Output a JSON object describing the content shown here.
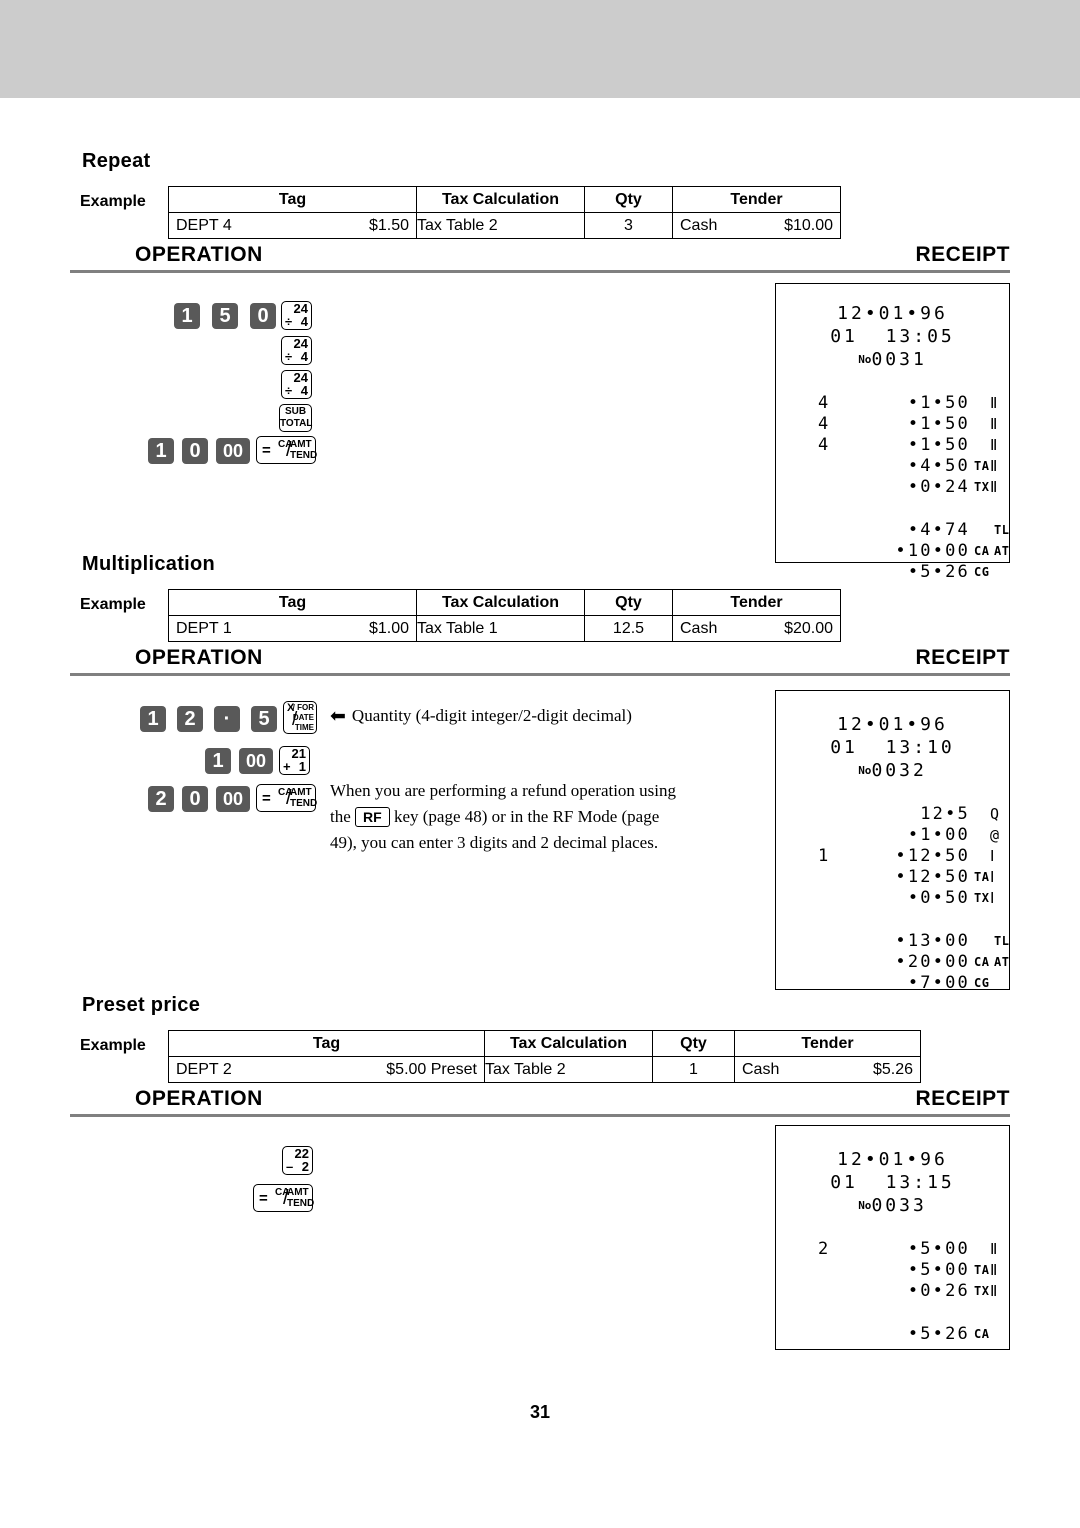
{
  "page": {
    "number": "31",
    "operation_label": "OPERATION",
    "receipt_label": "RECEIPT",
    "example_label": "Example"
  },
  "table_headers": {
    "tag": "Tag",
    "tax_calculation": "Tax Calculation",
    "qty": "Qty",
    "tender": "Tender"
  },
  "sections": [
    {
      "title": "Repeat",
      "example": {
        "tag_name": "DEPT 4",
        "tag_price": "$1.50",
        "tax_calculation": "Tax Table 2",
        "qty": "3",
        "tender_type": "Cash",
        "tender_amount": "$10.00"
      },
      "keys": [
        {
          "type": "num",
          "label": "1"
        },
        {
          "type": "num",
          "label": "5"
        },
        {
          "type": "num",
          "label": "0"
        },
        {
          "type": "dept",
          "top": "24",
          "op": "÷",
          "bottom": "4"
        },
        {
          "type": "dept",
          "top": "24",
          "op": "÷",
          "bottom": "4"
        },
        {
          "type": "dept",
          "top": "24",
          "op": "÷",
          "bottom": "4"
        },
        {
          "type": "subtotal",
          "line1": "SUB",
          "line2": "TOTAL"
        },
        {
          "type": "num",
          "label": "1"
        },
        {
          "type": "num",
          "label": "0"
        },
        {
          "type": "num2",
          "label": "00"
        },
        {
          "type": "ca",
          "eq": "=",
          "t1": "CA",
          "t2": "AMT",
          "t3": "TEND"
        }
      ],
      "receipt": {
        "date": "12•01•96",
        "clerk_time": "01  13:05",
        "no_prefix": "No",
        "no_value": "0031",
        "lines": [
          {
            "qty": "4",
            "amount": "•1•50",
            "sym": "",
            "sym2": "",
            "symbig": "Ⅱ"
          },
          {
            "qty": "4",
            "amount": "•1•50",
            "sym": "",
            "sym2": "",
            "symbig": "Ⅱ"
          },
          {
            "qty": "4",
            "amount": "•1•50",
            "sym": "",
            "sym2": "",
            "symbig": "Ⅱ"
          },
          {
            "qty": "",
            "amount": "•4•50",
            "sym": "TA",
            "sym2": "",
            "symbig": "Ⅱ"
          },
          {
            "qty": "",
            "amount": "•0•24",
            "sym": "TX",
            "sym2": "",
            "symbig": "Ⅱ"
          },
          {
            "gap": true
          },
          {
            "qty": "",
            "amount": "•4•74",
            "sym": "",
            "sym2": "TL",
            "symbig": ""
          },
          {
            "qty": "",
            "amount": "•10•00",
            "sym": "CA",
            "sym2": "AT",
            "symbig": ""
          },
          {
            "qty": "",
            "amount": "•5•26",
            "sym": "CG",
            "sym2": "",
            "symbig": ""
          }
        ]
      }
    },
    {
      "title": "Multiplication",
      "example": {
        "tag_name": "DEPT 1",
        "tag_price": "$1.00",
        "tax_calculation": "Tax Table 1",
        "qty": "12.5",
        "tender_type": "Cash",
        "tender_amount": "$20.00"
      },
      "keys": [
        {
          "type": "num",
          "label": "1"
        },
        {
          "type": "num",
          "label": "2"
        },
        {
          "type": "num",
          "label": "·"
        },
        {
          "type": "num",
          "label": "5"
        },
        {
          "type": "xfor",
          "x": "X",
          "a": "/ FOR",
          "b": "DATE",
          "c": "TIME"
        },
        {
          "type": "num",
          "label": "1"
        },
        {
          "type": "num2",
          "label": "00"
        },
        {
          "type": "dept",
          "top": "21",
          "op": "+",
          "bottom": "1"
        },
        {
          "type": "num",
          "label": "2"
        },
        {
          "type": "num",
          "label": "0"
        },
        {
          "type": "num2",
          "label": "00"
        },
        {
          "type": "ca",
          "eq": "=",
          "t1": "CA",
          "t2": "AMT",
          "t3": "TEND"
        }
      ],
      "annotation": "Quantity (4-digit integer/2-digit decimal)",
      "note_part1": "When you are performing a refund operation using",
      "note_part2_before": "the",
      "note_rf_key": "RF",
      "note_part2_after": "key (page 48) or in the RF Mode (page",
      "note_part3": "49),  you can enter 3 digits and 2 decimal places.",
      "receipt": {
        "date": "12•01•96",
        "clerk_time": "01  13:10",
        "no_prefix": "No",
        "no_value": "0032",
        "lines": [
          {
            "qty": "",
            "amount": "12•5",
            "sym": "",
            "sym2": "",
            "symbig": "Q"
          },
          {
            "qty": "",
            "amount": "•1•00",
            "sym": "",
            "sym2": "",
            "symbig": "@"
          },
          {
            "qty": "1",
            "amount": "•12•50",
            "sym": "",
            "sym2": "",
            "symbig": "Ⅰ"
          },
          {
            "qty": "",
            "amount": "•12•50",
            "sym": "TA",
            "sym2": "",
            "symbig": "Ⅰ"
          },
          {
            "qty": "",
            "amount": "•0•50",
            "sym": "TX",
            "sym2": "",
            "symbig": "Ⅰ"
          },
          {
            "gap": true
          },
          {
            "qty": "",
            "amount": "•13•00",
            "sym": "",
            "sym2": "TL",
            "symbig": ""
          },
          {
            "qty": "",
            "amount": "•20•00",
            "sym": "CA",
            "sym2": "AT",
            "symbig": ""
          },
          {
            "qty": "",
            "amount": "•7•00",
            "sym": "CG",
            "sym2": "",
            "symbig": ""
          }
        ]
      }
    },
    {
      "title": "Preset price",
      "example": {
        "tag_name": "DEPT 2",
        "tag_price": "$5.00 Preset",
        "tax_calculation": "Tax Table 2",
        "qty": "1",
        "tender_type": "Cash",
        "tender_amount": "$5.26"
      },
      "keys": [
        {
          "type": "dept",
          "top": "22",
          "op": "–",
          "bottom": "2"
        },
        {
          "type": "ca",
          "eq": "=",
          "t1": "CA",
          "t2": "AMT",
          "t3": "TEND"
        }
      ],
      "receipt": {
        "date": "12•01•96",
        "clerk_time": "01  13:15",
        "no_prefix": "No",
        "no_value": "0033",
        "lines": [
          {
            "qty": "2",
            "amount": "•5•00",
            "sym": "",
            "sym2": "",
            "symbig": "Ⅱ"
          },
          {
            "qty": "",
            "amount": "•5•00",
            "sym": "TA",
            "sym2": "",
            "symbig": "Ⅱ"
          },
          {
            "qty": "",
            "amount": "•0•26",
            "sym": "TX",
            "sym2": "",
            "symbig": "Ⅱ"
          },
          {
            "gap": true
          },
          {
            "qty": "",
            "amount": "•5•26",
            "sym": "CA",
            "sym2": "",
            "symbig": ""
          }
        ]
      }
    }
  ]
}
